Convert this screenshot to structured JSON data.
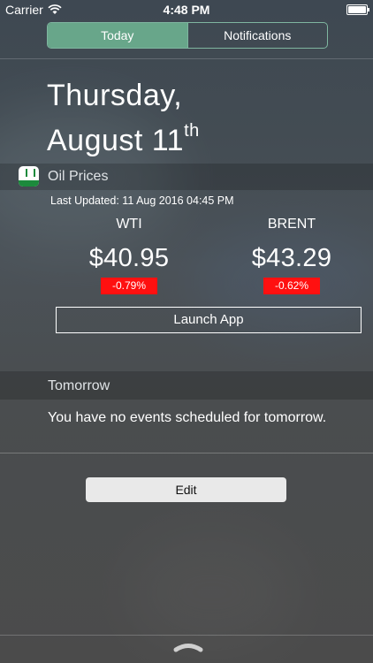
{
  "status_bar": {
    "carrier": "Carrier",
    "time": "4:48 PM"
  },
  "tabs": [
    {
      "label": "Today"
    },
    {
      "label": "Notifications"
    }
  ],
  "date": {
    "line1": "Thursday,",
    "line2": "August 11",
    "suffix": "th"
  },
  "widget": {
    "title": "Oil Prices",
    "last_updated": "Last Updated: 11 Aug 2016 04:45 PM",
    "prices": [
      {
        "name": "WTI",
        "value": "$40.95",
        "change": "-0.79%"
      },
      {
        "name": "BRENT",
        "value": "$43.29",
        "change": "-0.62%"
      }
    ],
    "launch_label": "Launch App"
  },
  "tomorrow": {
    "title": "Tomorrow",
    "message": "You have no events scheduled for tomorrow."
  },
  "edit_label": "Edit",
  "colors": {
    "accent": "#68a68a",
    "negative": "#ff1010",
    "brand": "#1c8a3c"
  }
}
